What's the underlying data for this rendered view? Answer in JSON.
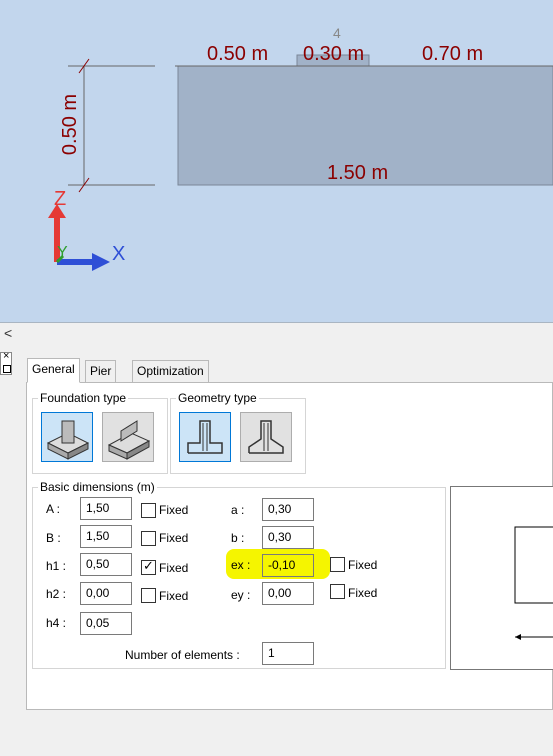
{
  "viewport": {
    "pier_label": "4",
    "dim_left": "0.50 m",
    "dim_mid": "0.30 m",
    "dim_right": "0.70 m",
    "dim_height": "0.50 m",
    "dim_bottom": "1.50 m",
    "axis_z": "Z",
    "axis_y": "Y",
    "axis_x": "X"
  },
  "collapse": {
    "arrow": "<",
    "close": "×"
  },
  "tabs": [
    "General",
    "Pier",
    "Optimization"
  ],
  "foundation_type": {
    "label": "Foundation type",
    "options": [
      "isolated-footing-icon",
      "strip-footing-icon"
    ],
    "selected": 0
  },
  "geometry_type": {
    "label": "Geometry type",
    "options": [
      "straight-footing-icon",
      "sloped-footing-icon"
    ],
    "selected": 0
  },
  "basic": {
    "label": "Basic dimensions (m)",
    "fixed_label": "Fixed",
    "A": {
      "label": "A :",
      "value": "1,50",
      "fixed": false
    },
    "B": {
      "label": "B :",
      "value": "1,50",
      "fixed": false
    },
    "h1": {
      "label": "h1 :",
      "value": "0,50",
      "fixed": true
    },
    "h2": {
      "label": "h2 :",
      "value": "0,00",
      "fixed": false
    },
    "h4": {
      "label": "h4 :",
      "value": "0,05"
    },
    "a": {
      "label": "a :",
      "value": "0,30"
    },
    "b": {
      "label": "b :",
      "value": "0,30"
    },
    "ex": {
      "label": "ex :",
      "value": "-0,10",
      "fixed": false
    },
    "ey": {
      "label": "ey :",
      "value": "0,00",
      "fixed": false
    },
    "elements": {
      "label": "Number of elements :",
      "value": "1"
    }
  },
  "colors": {
    "highlight": "#f5f500",
    "dimension": "#8b0000",
    "selected": "#cce4f7"
  }
}
